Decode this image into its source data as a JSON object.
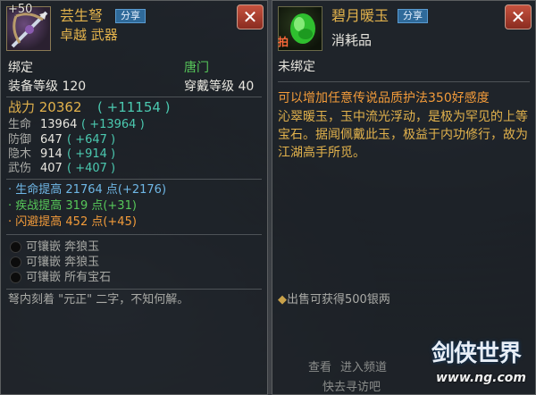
{
  "left": {
    "plus": "+50",
    "name": "芸生弩",
    "share": "分享",
    "quality": "卓越 武器",
    "close": "✕",
    "bind": "绑定",
    "school": "唐门",
    "equip_level": "装备等级 120",
    "wear_level": "穿戴等级 40",
    "power_label": "战力 20362",
    "power_bonus": "( +11154 )",
    "stats": [
      {
        "label": "生命",
        "value": "13964",
        "bonus": "( +13964 )"
      },
      {
        "label": "防御",
        "value": "647",
        "bonus": "( +647 )"
      },
      {
        "label": "隐木",
        "value": "914",
        "bonus": "( +914 )"
      },
      {
        "label": "武伤",
        "value": "407",
        "bonus": "( +407 )"
      }
    ],
    "extras": [
      {
        "text": "生命提高 21764 点",
        "bonus": "(+2176)"
      },
      {
        "text": "疾战提高 319 点",
        "bonus": "(+31)"
      },
      {
        "text": "闪避提高 452 点",
        "bonus": "(+45)"
      }
    ],
    "sockets": [
      "可镶嵌 奔狼玉",
      "可镶嵌 奔狼玉",
      "可镶嵌 所有宝石"
    ],
    "flavor": "弩内刻着 \"元正\" 二字，不知何解。"
  },
  "right": {
    "name": "碧月暖玉",
    "share": "分享",
    "type": "消耗品",
    "close": "✕",
    "bind_badge": "拍",
    "bind": "未绑定",
    "effect": "可以增加任意传说品质护法350好感度",
    "desc": "沁翠暖玉，玉中流光浮动，是极为罕见的上等宝石。据闻佩戴此玉，极益于内功修行，故为江湖高手所觅。",
    "sell": "出售可获得500银两",
    "bottom_a": "查看",
    "bottom_b": "进入频道",
    "bottom_c": "快去寻访吧",
    "logo": "剑侠世界",
    "watermark": "www.ng.com"
  },
  "colors": {
    "gold": "#e2b24c",
    "green": "#57c85a",
    "teal": "#4bc9b0",
    "orange": "#f29b3a",
    "close": "#b8412f"
  }
}
